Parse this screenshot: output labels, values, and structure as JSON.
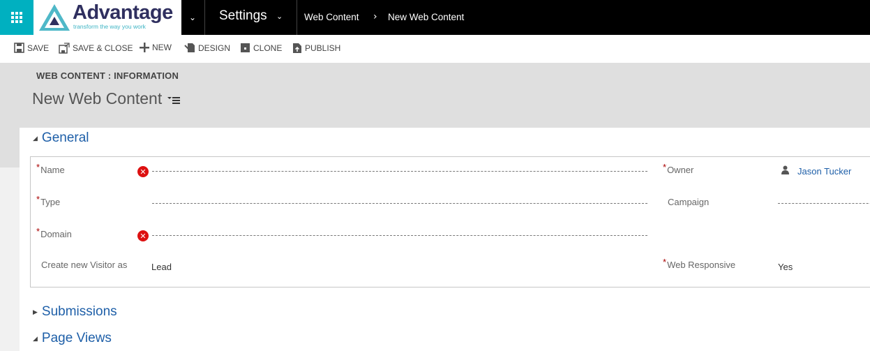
{
  "navbar": {
    "logo_text": "Advantage",
    "logo_tagline": "transform the way you work",
    "area": "Settings",
    "breadcrumb": [
      "Web Content",
      "New Web Content"
    ],
    "brand_color": "#00b0c0"
  },
  "commands": [
    {
      "label": "SAVE",
      "icon": "save-icon"
    },
    {
      "label": "SAVE & CLOSE",
      "icon": "save-close-icon"
    },
    {
      "label": "NEW",
      "icon": "plus-icon"
    },
    {
      "label": "DESIGN",
      "icon": "design-icon"
    },
    {
      "label": "CLONE",
      "icon": "clone-icon"
    },
    {
      "label": "PUBLISH",
      "icon": "publish-icon"
    }
  ],
  "header": {
    "entity_form": "WEB CONTENT : INFORMATION",
    "record_title": "New Web Content"
  },
  "sections": {
    "general": {
      "title": "General",
      "expanded": true,
      "fields": {
        "name": {
          "label": "Name",
          "required": true,
          "value": "",
          "error": true
        },
        "type": {
          "label": "Type",
          "required": true,
          "value": "",
          "error": false
        },
        "domain": {
          "label": "Domain",
          "required": true,
          "value": "",
          "error": true
        },
        "create_visitor": {
          "label": "Create new Visitor as",
          "required": false,
          "value": "Lead"
        },
        "owner": {
          "label": "Owner",
          "required": true,
          "value": "Jason Tucker",
          "icon": "user-icon"
        },
        "campaign": {
          "label": "Campaign",
          "required": false,
          "value": ""
        },
        "web_responsive": {
          "label": "Web Responsive",
          "required": true,
          "value": "Yes"
        }
      }
    },
    "submissions": {
      "title": "Submissions",
      "expanded": false
    },
    "page_views": {
      "title": "Page Views",
      "expanded": true
    }
  },
  "required_marker": "*",
  "error_glyph": "✕"
}
